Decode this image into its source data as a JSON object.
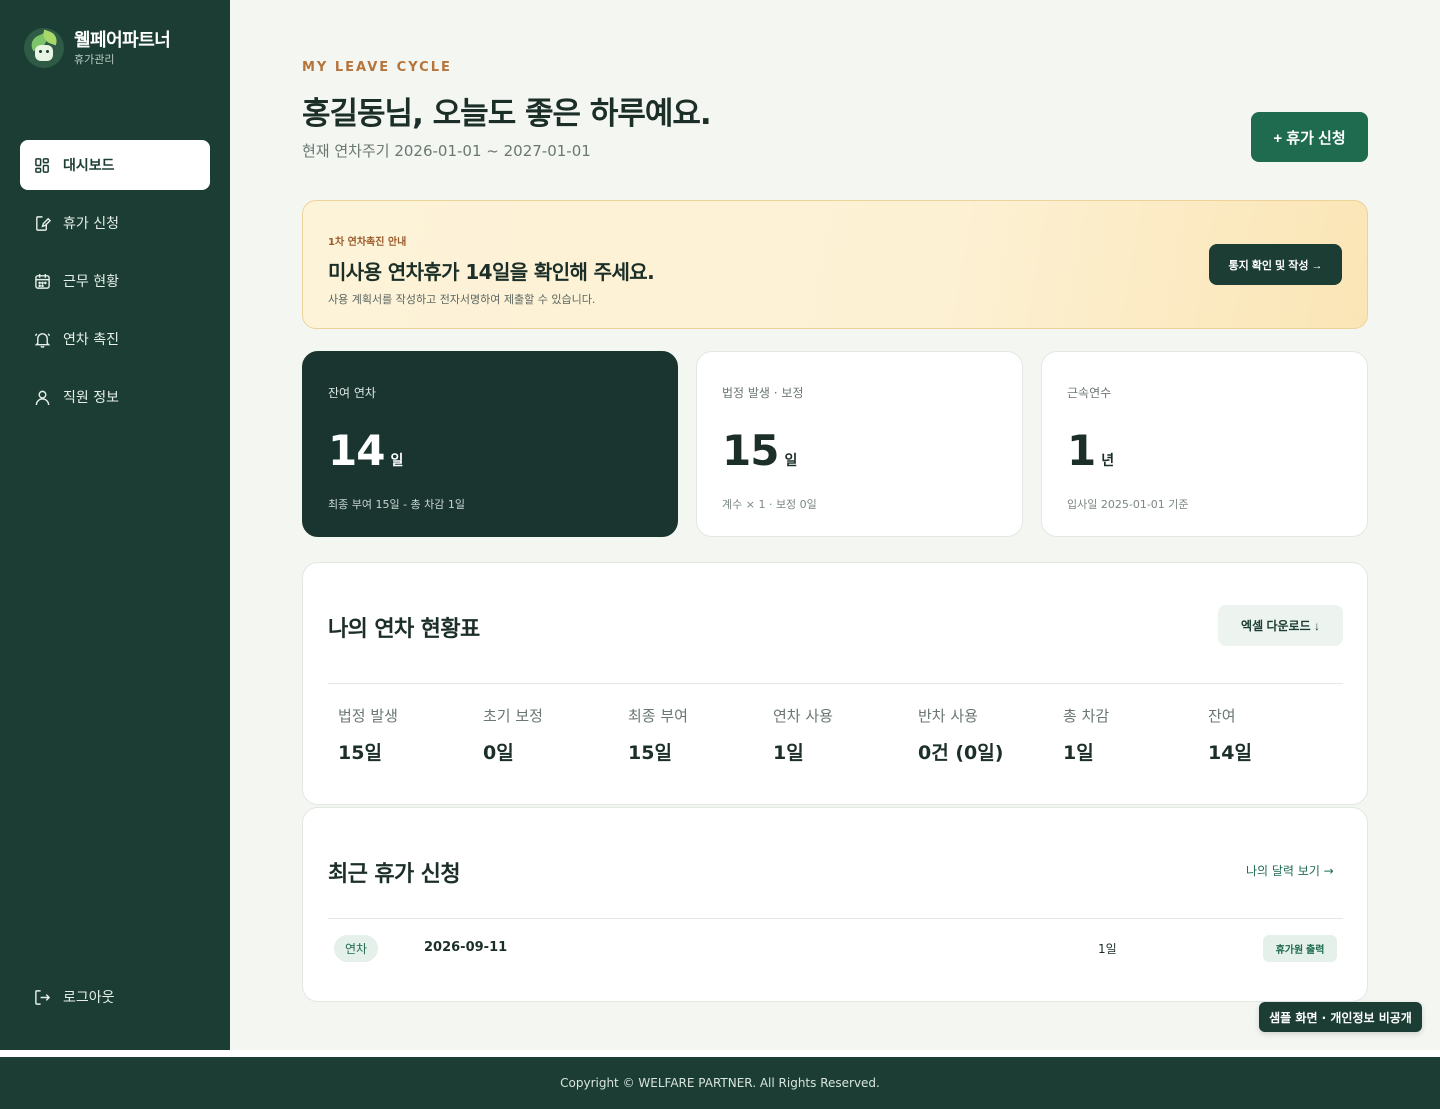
{
  "brand": {
    "name": "웰페어파트너",
    "sub": "휴가관리"
  },
  "nav": {
    "items": [
      {
        "label": "대시보드",
        "icon": "dashboard-icon",
        "active": true
      },
      {
        "label": "휴가 신청",
        "icon": "edit-document-icon"
      },
      {
        "label": "근무 현황",
        "icon": "calendar-icon"
      },
      {
        "label": "연차 촉진",
        "icon": "bell-icon"
      },
      {
        "label": "직원 정보",
        "icon": "user-icon"
      }
    ],
    "logout": {
      "label": "로그아웃",
      "icon": "logout-icon"
    }
  },
  "header": {
    "eyebrow": "MY LEAVE CYCLE",
    "greeting": "홍길동님, 오늘도 좋은 하루예요.",
    "cycle": "현재 연차주기 2026-01-01 ~ 2027-01-01",
    "apply_button": "+ 휴가 신청"
  },
  "notice": {
    "tag": "1차 연차촉진 안내",
    "title": "미사용 연차휴가 14일을 확인해 주세요.",
    "desc": "사용 계획서를 작성하고 전자서명하여 제출할 수 있습니다.",
    "button": "통지 확인 및 작성 →"
  },
  "cards": [
    {
      "label": "잔여 연차",
      "value": "14",
      "unit": "일",
      "note": "최종 부여 15일 - 총 차감 1일"
    },
    {
      "label": "법정 발생 · 보정",
      "value": "15",
      "unit": "일",
      "note": "계수 × 1 · 보정 0일"
    },
    {
      "label": "근속연수",
      "value": "1",
      "unit": "년",
      "note": "입사일 2025-01-01 기준"
    }
  ],
  "summary": {
    "title": "나의 연차 현황표",
    "excel_button": "엑셀 다운로드 ↓",
    "stats": [
      {
        "label": "법정 발생",
        "value": "15일"
      },
      {
        "label": "초기 보정",
        "value": "0일"
      },
      {
        "label": "최종 부여",
        "value": "15일"
      },
      {
        "label": "연차 사용",
        "value": "1일"
      },
      {
        "label": "반차 사용",
        "value": "0건 (0일)"
      },
      {
        "label": "총 차감",
        "value": "1일"
      },
      {
        "label": "잔여",
        "value": "14일"
      }
    ]
  },
  "recent": {
    "title": "최근 휴가 신청",
    "calendar_link": "나의 달력 보기 →",
    "rows": [
      {
        "type": "연차",
        "date": "2026-09-11",
        "days": "1일",
        "action": "휴가원 출력"
      }
    ]
  },
  "sample_badge": "샘플 화면 · 개인정보 비공개",
  "footer": "Copyright © WELFARE PARTNER. All Rights Reserved.",
  "colors": {
    "sidebar": "#1b3d33",
    "accent": "#1f6b50",
    "eyebrow": "#b5743a",
    "notice_bg": "#fdf1d4"
  }
}
